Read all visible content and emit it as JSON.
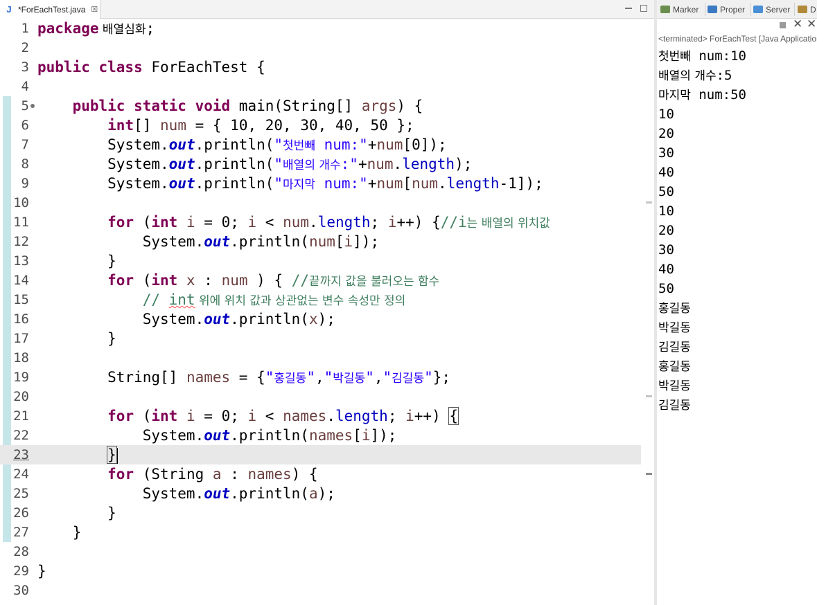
{
  "editor": {
    "tab": {
      "icon": "java-file-icon",
      "label": "*ForEachTest.java",
      "close": "close-icon"
    },
    "current_line": 23,
    "lines": [
      {
        "n": "1",
        "segs": [
          [
            "kw",
            "package"
          ],
          [
            "",
            ""
          ],
          [
            "ko",
            " 배열심화"
          ],
          [
            "",
            ";"
          ]
        ]
      },
      {
        "n": "2",
        "segs": []
      },
      {
        "n": "3",
        "segs": [
          [
            "kw",
            "public class"
          ],
          [
            "",
            " ForEachTest {"
          ]
        ]
      },
      {
        "n": "4",
        "segs": []
      },
      {
        "n": "5",
        "fold": true,
        "segs": [
          [
            "",
            "    "
          ],
          [
            "kw",
            "public static void"
          ],
          [
            "",
            " main(String[] "
          ],
          [
            "var",
            "args"
          ],
          [
            "",
            ") {"
          ]
        ]
      },
      {
        "n": "6",
        "segs": [
          [
            "",
            "        "
          ],
          [
            "kw",
            "int"
          ],
          [
            "",
            "[] "
          ],
          [
            "var",
            "num"
          ],
          [
            "",
            " = { 10, 20, 30, 40, 50 };"
          ]
        ]
      },
      {
        "n": "7",
        "segs": [
          [
            "",
            "        System."
          ],
          [
            "sfld",
            "out"
          ],
          [
            "",
            ".println("
          ],
          [
            "st",
            "\""
          ],
          [
            "st ko",
            "첫번빼"
          ],
          [
            "st",
            " num:\""
          ],
          [
            "",
            "+"
          ],
          [
            "var",
            "num"
          ],
          [
            "",
            "[0]);"
          ]
        ]
      },
      {
        "n": "8",
        "segs": [
          [
            "",
            "        System."
          ],
          [
            "sfld",
            "out"
          ],
          [
            "",
            ".println("
          ],
          [
            "st",
            "\""
          ],
          [
            "st ko",
            "배열의 개수"
          ],
          [
            "st",
            ":\""
          ],
          [
            "",
            "+"
          ],
          [
            "var",
            "num"
          ],
          [
            "",
            "."
          ],
          [
            "fld",
            "length"
          ],
          [
            "",
            ");"
          ]
        ]
      },
      {
        "n": "9",
        "segs": [
          [
            "",
            "        System."
          ],
          [
            "sfld",
            "out"
          ],
          [
            "",
            ".println("
          ],
          [
            "st",
            "\""
          ],
          [
            "st ko",
            "마지막"
          ],
          [
            "st",
            " num:\""
          ],
          [
            "",
            "+"
          ],
          [
            "var",
            "num"
          ],
          [
            "",
            "["
          ],
          [
            "var",
            "num"
          ],
          [
            "",
            "."
          ],
          [
            "fld",
            "length"
          ],
          [
            "",
            "-1]);"
          ]
        ]
      },
      {
        "n": "10",
        "segs": []
      },
      {
        "n": "11",
        "segs": [
          [
            "",
            "        "
          ],
          [
            "kw",
            "for"
          ],
          [
            "",
            " ("
          ],
          [
            "kw",
            "int"
          ],
          [
            "",
            " "
          ],
          [
            "var",
            "i"
          ],
          [
            "",
            " = 0; "
          ],
          [
            "var",
            "i"
          ],
          [
            "",
            " < "
          ],
          [
            "var",
            "num"
          ],
          [
            "",
            "."
          ],
          [
            "fld",
            "length"
          ],
          [
            "",
            "; "
          ],
          [
            "var",
            "i"
          ],
          [
            "",
            "++) {"
          ],
          [
            "cm",
            "//i"
          ],
          [
            "cm ko",
            "는 배열의 위치값"
          ]
        ]
      },
      {
        "n": "12",
        "segs": [
          [
            "",
            "            System."
          ],
          [
            "sfld",
            "out"
          ],
          [
            "",
            ".println("
          ],
          [
            "var",
            "num"
          ],
          [
            "",
            "["
          ],
          [
            "var",
            "i"
          ],
          [
            "",
            "]);"
          ]
        ]
      },
      {
        "n": "13",
        "segs": [
          [
            "",
            "        }"
          ]
        ]
      },
      {
        "n": "14",
        "segs": [
          [
            "",
            "        "
          ],
          [
            "kw",
            "for"
          ],
          [
            "",
            " ("
          ],
          [
            "kw",
            "int"
          ],
          [
            "",
            " "
          ],
          [
            "var",
            "x"
          ],
          [
            "",
            " : "
          ],
          [
            "var",
            "num"
          ],
          [
            "",
            " ) { "
          ],
          [
            "cm",
            "//"
          ],
          [
            "cm ko",
            "끝까지 값을 불러오는 함수"
          ]
        ]
      },
      {
        "n": "15",
        "segs": [
          [
            "",
            "            "
          ],
          [
            "cm",
            "// "
          ],
          [
            "cm sq",
            "int"
          ],
          [
            "cm ko",
            " 위에 위치 값과 상관없는 변수 속성만 정의"
          ]
        ]
      },
      {
        "n": "16",
        "segs": [
          [
            "",
            "            System."
          ],
          [
            "sfld",
            "out"
          ],
          [
            "",
            ".println("
          ],
          [
            "var",
            "x"
          ],
          [
            "",
            ");"
          ]
        ]
      },
      {
        "n": "17",
        "segs": [
          [
            "",
            "        }"
          ]
        ]
      },
      {
        "n": "18",
        "segs": []
      },
      {
        "n": "19",
        "segs": [
          [
            "",
            "        String[] "
          ],
          [
            "var",
            "names"
          ],
          [
            "",
            " = {"
          ],
          [
            "st",
            "\""
          ],
          [
            "st ko",
            "홍길동"
          ],
          [
            "st",
            "\""
          ],
          [
            "",
            ","
          ],
          [
            "st",
            "\""
          ],
          [
            "st ko",
            "박길동"
          ],
          [
            "st",
            "\""
          ],
          [
            "",
            ","
          ],
          [
            "st",
            "\""
          ],
          [
            "st ko",
            "김길동"
          ],
          [
            "st",
            "\""
          ],
          [
            "",
            "};"
          ]
        ]
      },
      {
        "n": "20",
        "segs": []
      },
      {
        "n": "21",
        "segs": [
          [
            "",
            "        "
          ],
          [
            "kw",
            "for"
          ],
          [
            "",
            " ("
          ],
          [
            "kw",
            "int"
          ],
          [
            "",
            " "
          ],
          [
            "var",
            "i"
          ],
          [
            "",
            " = 0; "
          ],
          [
            "var",
            "i"
          ],
          [
            "",
            " < "
          ],
          [
            "var",
            "names"
          ],
          [
            "",
            "."
          ],
          [
            "fld",
            "length"
          ],
          [
            "",
            "; "
          ],
          [
            "var",
            "i"
          ],
          [
            "",
            "++) "
          ],
          [
            "bracket",
            "{"
          ]
        ]
      },
      {
        "n": "22",
        "segs": [
          [
            "",
            "            System."
          ],
          [
            "sfld",
            "out"
          ],
          [
            "",
            ".println("
          ],
          [
            "var",
            "names"
          ],
          [
            "",
            "["
          ],
          [
            "var",
            "i"
          ],
          [
            "",
            "]);"
          ]
        ]
      },
      {
        "n": "23",
        "segs": [
          [
            "",
            "        "
          ],
          [
            "bracket",
            "}"
          ],
          [
            "caret",
            ""
          ]
        ]
      },
      {
        "n": "24",
        "segs": [
          [
            "",
            "        "
          ],
          [
            "kw",
            "for"
          ],
          [
            "",
            " (String "
          ],
          [
            "var",
            "a"
          ],
          [
            "",
            " : "
          ],
          [
            "var",
            "names"
          ],
          [
            "",
            ") {"
          ]
        ]
      },
      {
        "n": "25",
        "segs": [
          [
            "",
            "            System."
          ],
          [
            "sfld",
            "out"
          ],
          [
            "",
            ".println("
          ],
          [
            "var",
            "a"
          ],
          [
            "",
            ");"
          ]
        ]
      },
      {
        "n": "26",
        "segs": [
          [
            "",
            "        }"
          ]
        ]
      },
      {
        "n": "27",
        "segs": [
          [
            "",
            "    }"
          ]
        ]
      },
      {
        "n": "28",
        "segs": []
      },
      {
        "n": "29",
        "segs": [
          [
            "",
            "}"
          ]
        ]
      },
      {
        "n": "30",
        "segs": []
      }
    ]
  },
  "console": {
    "tabs": [
      {
        "icon": "marker",
        "label": "Marker"
      },
      {
        "icon": "prop",
        "label": "Proper"
      },
      {
        "icon": "server",
        "label": "Server"
      },
      {
        "icon": "data",
        "label": "D"
      }
    ],
    "terminated": "<terminated> ForEachTest [Java Application]",
    "output": [
      [
        [
          "ko",
          "첫번빼"
        ],
        [
          "",
          " num:10"
        ]
      ],
      [
        [
          "ko",
          "배열의 개수"
        ],
        [
          "",
          ":5"
        ]
      ],
      [
        [
          "ko",
          "마지막"
        ],
        [
          "",
          " num:50"
        ]
      ],
      [
        [
          "",
          "10"
        ]
      ],
      [
        [
          "",
          "20"
        ]
      ],
      [
        [
          "",
          "30"
        ]
      ],
      [
        [
          "",
          "40"
        ]
      ],
      [
        [
          "",
          "50"
        ]
      ],
      [
        [
          "",
          "10"
        ]
      ],
      [
        [
          "",
          "20"
        ]
      ],
      [
        [
          "",
          "30"
        ]
      ],
      [
        [
          "",
          "40"
        ]
      ],
      [
        [
          "",
          "50"
        ]
      ],
      [
        [
          "ko",
          "홍길동"
        ]
      ],
      [
        [
          "ko",
          "박길동"
        ]
      ],
      [
        [
          "ko",
          "김길동"
        ]
      ],
      [
        [
          "ko",
          "홍길동"
        ]
      ],
      [
        [
          "ko",
          "박길동"
        ]
      ],
      [
        [
          "ko",
          "김길동"
        ]
      ]
    ]
  }
}
